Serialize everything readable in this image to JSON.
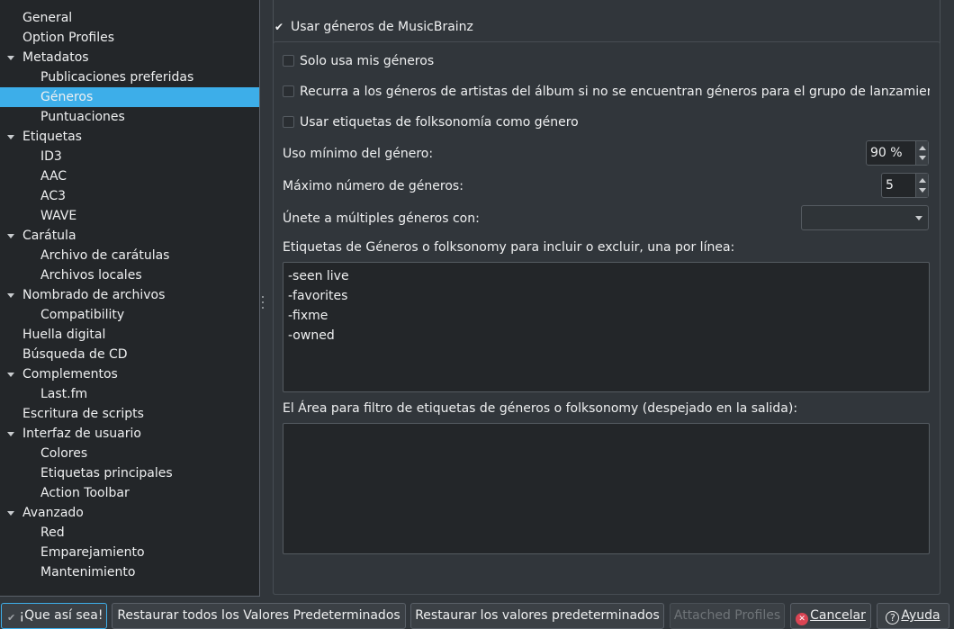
{
  "sidebar": {
    "items": [
      {
        "label": "General",
        "level": 0,
        "expanded": false,
        "selected": false
      },
      {
        "label": "Option Profiles",
        "level": 0,
        "expanded": false,
        "selected": false
      },
      {
        "label": "Metadatos",
        "level": 0,
        "expanded": true,
        "selected": false
      },
      {
        "label": "Publicaciones preferidas",
        "level": 1,
        "expanded": false,
        "selected": false
      },
      {
        "label": "Géneros",
        "level": 1,
        "expanded": false,
        "selected": true
      },
      {
        "label": "Puntuaciones",
        "level": 1,
        "expanded": false,
        "selected": false
      },
      {
        "label": "Etiquetas",
        "level": 0,
        "expanded": true,
        "selected": false
      },
      {
        "label": "ID3",
        "level": 1,
        "expanded": false,
        "selected": false
      },
      {
        "label": "AAC",
        "level": 1,
        "expanded": false,
        "selected": false
      },
      {
        "label": "AC3",
        "level": 1,
        "expanded": false,
        "selected": false
      },
      {
        "label": "WAVE",
        "level": 1,
        "expanded": false,
        "selected": false
      },
      {
        "label": "Carátula",
        "level": 0,
        "expanded": true,
        "selected": false
      },
      {
        "label": "Archivo de carátulas",
        "level": 1,
        "expanded": false,
        "selected": false
      },
      {
        "label": "Archivos locales",
        "level": 1,
        "expanded": false,
        "selected": false
      },
      {
        "label": "Nombrado de archivos",
        "level": 0,
        "expanded": true,
        "selected": false
      },
      {
        "label": "Compatibility",
        "level": 1,
        "expanded": false,
        "selected": false
      },
      {
        "label": "Huella digital",
        "level": 0,
        "expanded": false,
        "selected": false
      },
      {
        "label": "Búsqueda de CD",
        "level": 0,
        "expanded": false,
        "selected": false
      },
      {
        "label": "Complementos",
        "level": 0,
        "expanded": true,
        "selected": false
      },
      {
        "label": "Last.fm",
        "level": 1,
        "expanded": false,
        "selected": false
      },
      {
        "label": "Escritura de scripts",
        "level": 0,
        "expanded": false,
        "selected": false
      },
      {
        "label": "Interfaz de usuario",
        "level": 0,
        "expanded": true,
        "selected": false
      },
      {
        "label": "Colores",
        "level": 1,
        "expanded": false,
        "selected": false
      },
      {
        "label": "Etiquetas principales",
        "level": 1,
        "expanded": false,
        "selected": false
      },
      {
        "label": "Action Toolbar",
        "level": 1,
        "expanded": false,
        "selected": false
      },
      {
        "label": "Avanzado",
        "level": 0,
        "expanded": true,
        "selected": false
      },
      {
        "label": "Red",
        "level": 1,
        "expanded": false,
        "selected": false
      },
      {
        "label": "Emparejamiento",
        "level": 1,
        "expanded": false,
        "selected": false
      },
      {
        "label": "Mantenimiento",
        "level": 1,
        "expanded": false,
        "selected": false
      }
    ]
  },
  "genres": {
    "use_musicbrainz_label": "Usar géneros de MusicBrainz",
    "use_musicbrainz_checked": true,
    "only_my_genres_label": "Solo usa mis géneros",
    "only_my_genres_checked": false,
    "artist_fallback_label": "Recurra a los géneros de artistas del álbum si no se encuentran géneros para el grupo de lanzamier",
    "artist_fallback_checked": false,
    "folksonomy_label": "Usar etiquetas de folksonomía como género",
    "folksonomy_checked": false,
    "min_usage_label": "Uso mínimo del género:",
    "min_usage_value": "90 %",
    "max_genres_label": "Máximo número de géneros:",
    "max_genres_value": "5",
    "join_label": "Únete a múltiples géneros con:",
    "join_value": "",
    "include_exclude_label": "Etiquetas de Géneros o folksonomy para incluir o excluir, una por línea:",
    "include_exclude_lines": [
      "-seen live",
      "-favorites",
      "-fixme",
      "-owned"
    ],
    "filter_area_label": "El Área para filtro de etiquetas de géneros o folksonomy (despejado en la salida):"
  },
  "buttons": {
    "ok_label": "¡Que así sea!",
    "restore_all_label": "Restaurar todos los Valores Predeterminados",
    "restore_defaults_label": "Restaurar los valores predeterminados",
    "attached_profiles_label": "Attached Profiles",
    "cancel_label": "Cancelar",
    "help_label": "Ayuda"
  },
  "colors": {
    "selection": "#3daee9",
    "background": "#31363b",
    "field": "#232629",
    "cancel_icon": "#da4453"
  }
}
